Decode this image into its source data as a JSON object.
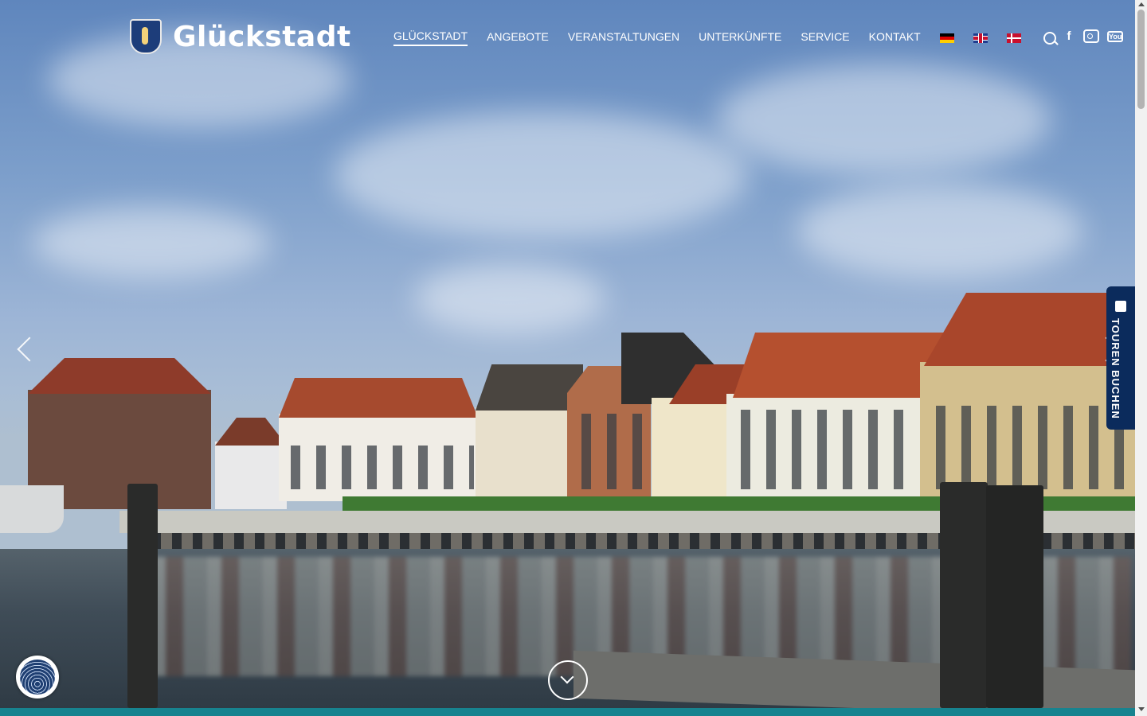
{
  "site": {
    "logo_text": "Glückstadt"
  },
  "nav": {
    "items": [
      {
        "label": "GLÜCKSTADT",
        "active": true
      },
      {
        "label": "ANGEBOTE",
        "active": false
      },
      {
        "label": "VERANSTALTUNGEN",
        "active": false
      },
      {
        "label": "UNTERKÜNFTE",
        "active": false
      },
      {
        "label": "SERVICE",
        "active": false
      },
      {
        "label": "KONTAKT",
        "active": false
      }
    ],
    "languages": [
      "de-flag-icon",
      "en-flag-icon",
      "dk-flag-icon"
    ],
    "search_icon": "search-icon"
  },
  "social": {
    "facebook": "f",
    "youtube": "You"
  },
  "tour_tab": {
    "label": "TOUREN BUCHEN"
  },
  "colors": {
    "accent_dark_blue": "#0b2b5c",
    "footer_teal": "#17838f"
  }
}
